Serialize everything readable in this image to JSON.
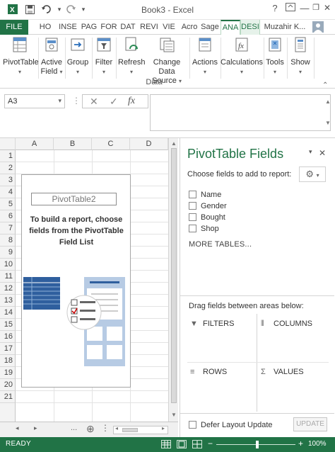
{
  "window": {
    "title": "Book3 - Excel",
    "help": "?",
    "minimize": "—",
    "restore": "❐",
    "close": "✕"
  },
  "quick_access": {
    "save_icon": "save-icon",
    "undo_icon": "undo-icon",
    "redo_icon": "redo-icon"
  },
  "tabs": [
    {
      "label": "FILE"
    },
    {
      "label": "HO"
    },
    {
      "label": "INSE"
    },
    {
      "label": "PAG"
    },
    {
      "label": "FOR"
    },
    {
      "label": "DAT"
    },
    {
      "label": "REVI"
    },
    {
      "label": "VIE"
    },
    {
      "label": "Acro"
    },
    {
      "label": "Sage"
    },
    {
      "label": "ANA"
    },
    {
      "label": "DESI"
    }
  ],
  "user": {
    "name": "Muzahir K..."
  },
  "ribbon": {
    "pivottable": "PivotTable",
    "active_field_1": "Active",
    "active_field_2": "Field",
    "group": "Group",
    "filter": "Filter",
    "refresh": "Refresh",
    "change_source_1": "Change Data",
    "change_source_2": "Source",
    "actions": "Actions",
    "calculations": "Calculations",
    "tools": "Tools",
    "show": "Show",
    "data_group_label": "Data"
  },
  "formula_bar": {
    "name_box": "A3",
    "cancel": "✕",
    "enter": "✓",
    "fx": "fx",
    "value": ""
  },
  "sheet": {
    "columns": [
      "A",
      "B",
      "C",
      "D"
    ],
    "rows": [
      "1",
      "2",
      "3",
      "4",
      "5",
      "6",
      "7",
      "8",
      "9",
      "10",
      "11",
      "12",
      "13",
      "14",
      "15",
      "16",
      "17",
      "18",
      "19",
      "20",
      "21"
    ]
  },
  "pivot_placeholder": {
    "name": "PivotTable2",
    "message": "To build a report, choose fields from the PivotTable Field List"
  },
  "sheet_tabs": {
    "ellipsis": "...",
    "add": "⊕"
  },
  "pivot_pane": {
    "title": "PivotTable Fields",
    "subtitle": "Choose fields to add to report:",
    "fields": [
      {
        "label": "Name",
        "checked": false
      },
      {
        "label": "Gender",
        "checked": false
      },
      {
        "label": "Bought",
        "checked": false
      },
      {
        "label": "Shop",
        "checked": false
      }
    ],
    "more_tables": "MORE TABLES...",
    "drag_label": "Drag fields between areas below:",
    "areas": {
      "filters": "FILTERS",
      "columns": "COLUMNS",
      "rows": "ROWS",
      "values": "VALUES"
    },
    "defer_label": "Defer Layout Update",
    "update_button": "UPDATE"
  },
  "status": {
    "ready": "READY",
    "zoom_minus": "−",
    "zoom_plus": "+",
    "zoom": "100%"
  },
  "colors": {
    "accent": "#217346"
  }
}
